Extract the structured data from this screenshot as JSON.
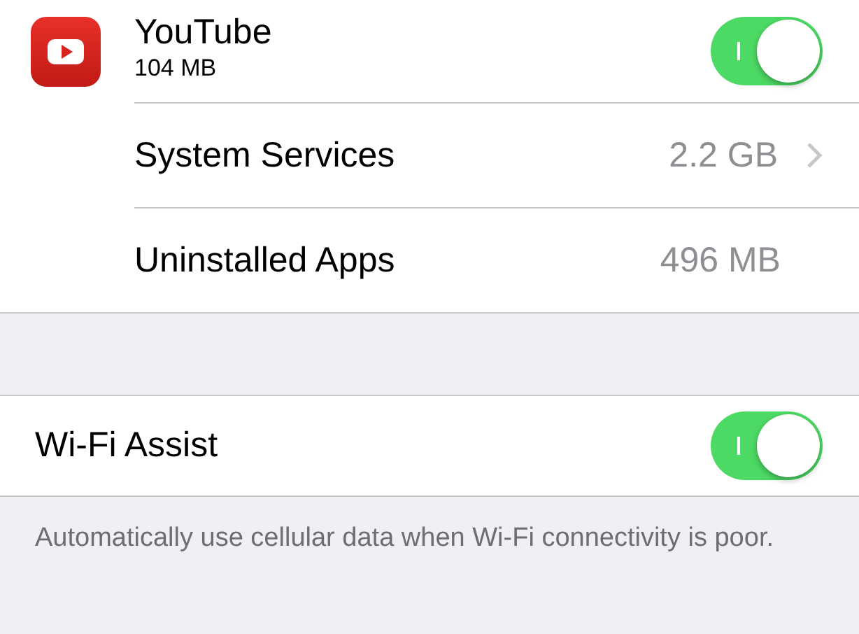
{
  "apps": [
    {
      "name": "YouTube",
      "size": "104 MB",
      "on": true
    }
  ],
  "rows": [
    {
      "label": "System Services",
      "value": "2.2 GB",
      "chevron": true
    },
    {
      "label": "Uninstalled Apps",
      "value": "496 MB",
      "chevron": false
    }
  ],
  "wifi_assist": {
    "label": "Wi-Fi Assist",
    "on": true
  },
  "footer": "Automatically use cellular data when Wi-Fi connectivity is poor."
}
